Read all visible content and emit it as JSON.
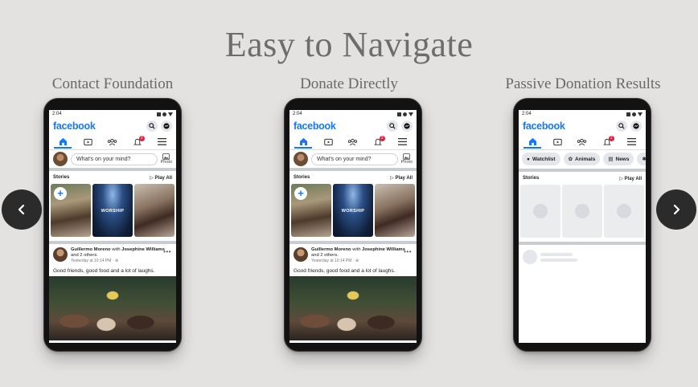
{
  "page": {
    "title": "Easy to Navigate",
    "columns": [
      {
        "title": "Contact Foundation"
      },
      {
        "title": "Donate Directly"
      },
      {
        "title": "Passive Donation Results"
      }
    ],
    "prev_icon": "chevron-left-icon",
    "next_icon": "chevron-right-icon"
  },
  "phone": {
    "time": "2:04",
    "logo": "facebook",
    "composer_placeholder": "What's on your mind?",
    "photo_label": "Photo",
    "stories_label": "Stories",
    "play_all_label": "Play All",
    "story_worship_label": "WORSHIP",
    "post": {
      "author": "Guillermo Moreno",
      "with_text": "with",
      "tagged": "Josephine Williams",
      "and_others": "and 2 others.",
      "time": "Yesterday at 10:14 PM",
      "text": "Good friends, good food and a lot of laughs."
    },
    "notification_count": "2",
    "chips": [
      "Watchlist",
      "Animals",
      "News"
    ],
    "colors": {
      "brand": "#1877f2",
      "badge": "#e41e3f"
    }
  }
}
